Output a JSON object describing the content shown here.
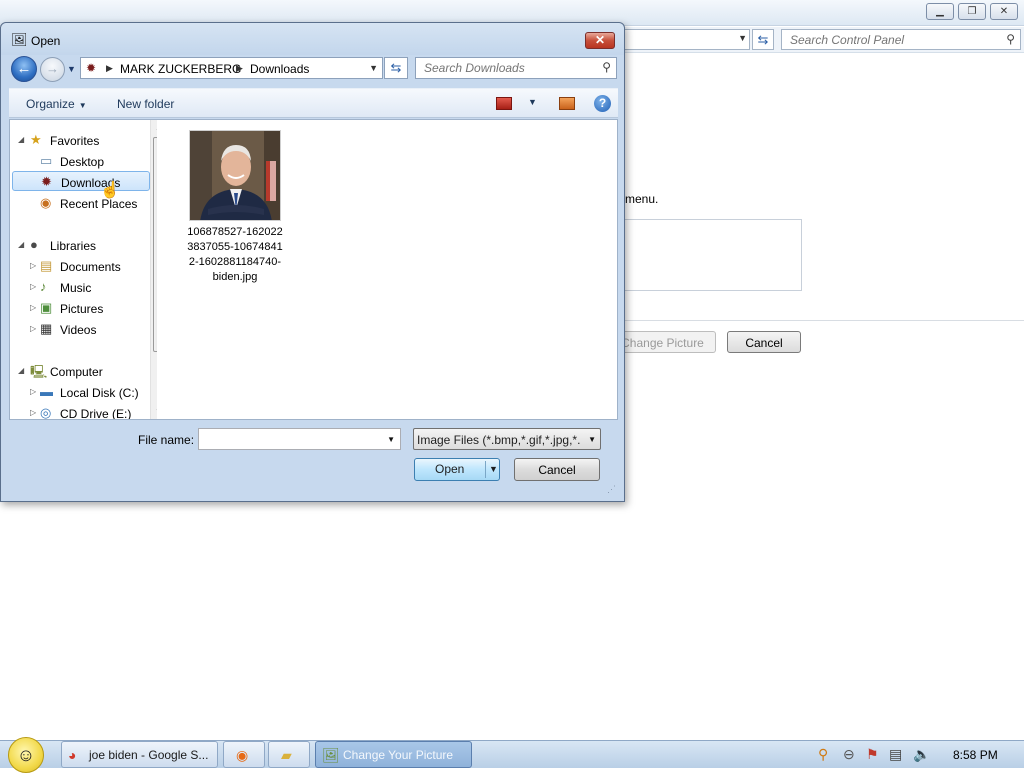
{
  "background_window": {
    "search_placeholder": "Search Control Panel",
    "instruction_fragment": "menu.",
    "change_picture_label": "Change Picture",
    "cancel_label": "Cancel"
  },
  "dialog": {
    "title": "Open",
    "close_glyph": "✕",
    "breadcrumb": [
      "MARK ZUCKERBERG",
      "Downloads"
    ],
    "search_placeholder": "Search Downloads",
    "toolbar": {
      "organize_label": "Organize",
      "new_folder_label": "New folder",
      "help_glyph": "?"
    },
    "nav": {
      "favorites": "Favorites",
      "desktop": "Desktop",
      "downloads": "Downloads",
      "recent_places": "Recent Places",
      "libraries": "Libraries",
      "documents": "Documents",
      "music": "Music",
      "pictures": "Pictures",
      "videos": "Videos",
      "computer": "Computer",
      "local_disk": "Local Disk (C:)",
      "cd_drive": "CD Drive (E:)"
    },
    "file": {
      "name": "106878527-1620223837055-106748412-1602881184740-biden.jpg",
      "thumbnail_icon": "portrait-photo-thumbnail"
    },
    "file_name_label": "File name:",
    "file_name_value": "",
    "file_type_filter": "Image Files (*.bmp,*.gif,*.jpg,*.",
    "open_label": "Open",
    "cancel_label": "Cancel"
  },
  "taskbar": {
    "tasks": [
      {
        "label": "joe biden - Google S...",
        "icon": "chrome-icon"
      },
      {
        "label": "",
        "icon": "firefox-icon"
      },
      {
        "label": "",
        "icon": "folder-icon"
      },
      {
        "label": "Change Your Picture",
        "icon": "control-panel-icon"
      }
    ],
    "clock": "8:58 PM"
  },
  "colors": {
    "dialog_frame": "#c7d9ee",
    "selection": "#cde4fb",
    "close_button": "#c7503b",
    "taskbar": "#b9cfe6"
  }
}
